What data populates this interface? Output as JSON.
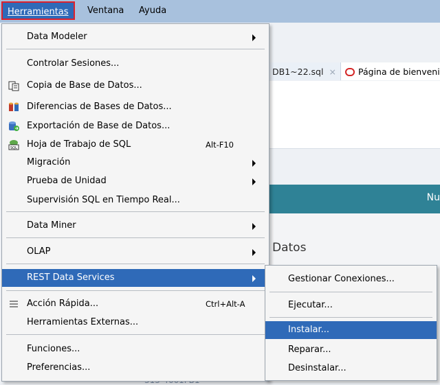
{
  "menubar": {
    "items": [
      {
        "label": "Herramientas",
        "active": true
      },
      {
        "label": "Ventana",
        "active": false
      },
      {
        "label": "Ayuda",
        "active": false
      }
    ]
  },
  "background": {
    "tabs": [
      {
        "label": "DB1~22.sql",
        "close": "×"
      },
      {
        "label": "Página de bienvenida",
        "icon": "oracle-logo-icon"
      }
    ],
    "banner_text": "Nu",
    "section_heading": "Datos",
    "partial_bottom_text": "313-4661FB1"
  },
  "tools_menu": {
    "items": [
      {
        "label": "Data Modeler",
        "submenu": true
      },
      {
        "separator": true
      },
      {
        "label": "Controlar Sesiones..."
      },
      {
        "label": "Copia de Base de Datos...",
        "icon": "database-copy-icon"
      },
      {
        "label": "Diferencias de Bases de Datos...",
        "icon": "database-diff-icon"
      },
      {
        "label": "Exportación de Base de Datos...",
        "icon": "database-export-icon"
      },
      {
        "label": "Hoja de Trabajo de SQL",
        "icon": "sql-worksheet-icon",
        "shortcut": "Alt-F10"
      },
      {
        "label": "Migración",
        "submenu": true
      },
      {
        "label": "Prueba de Unidad",
        "submenu": true
      },
      {
        "label": "Supervisión SQL en Tiempo Real..."
      },
      {
        "separator": true
      },
      {
        "label": "Data Miner",
        "submenu": true
      },
      {
        "separator": true
      },
      {
        "label": "OLAP",
        "submenu": true
      },
      {
        "separator": true
      },
      {
        "label": "REST Data Services",
        "submenu": true,
        "highlighted": true
      },
      {
        "separator": true
      },
      {
        "label": "Acción Rápida...",
        "icon": "list-lines-icon",
        "shortcut": "Ctrl+Alt-A"
      },
      {
        "label": "Herramientas Externas..."
      },
      {
        "separator": true
      },
      {
        "label": "Funciones..."
      },
      {
        "label": "Preferencias..."
      }
    ]
  },
  "rest_submenu": {
    "items": [
      {
        "label": "Gestionar Conexiones..."
      },
      {
        "separator": true
      },
      {
        "label": "Ejecutar..."
      },
      {
        "separator": true
      },
      {
        "label": "Instalar...",
        "highlighted": true
      },
      {
        "label": "Reparar..."
      },
      {
        "label": "Desinstalar..."
      }
    ]
  },
  "colors": {
    "menubar_bg": "#a8c1dd",
    "highlight": "#2f6ab8",
    "active_border": "#e0202a",
    "banner_teal": "#2f8296"
  }
}
